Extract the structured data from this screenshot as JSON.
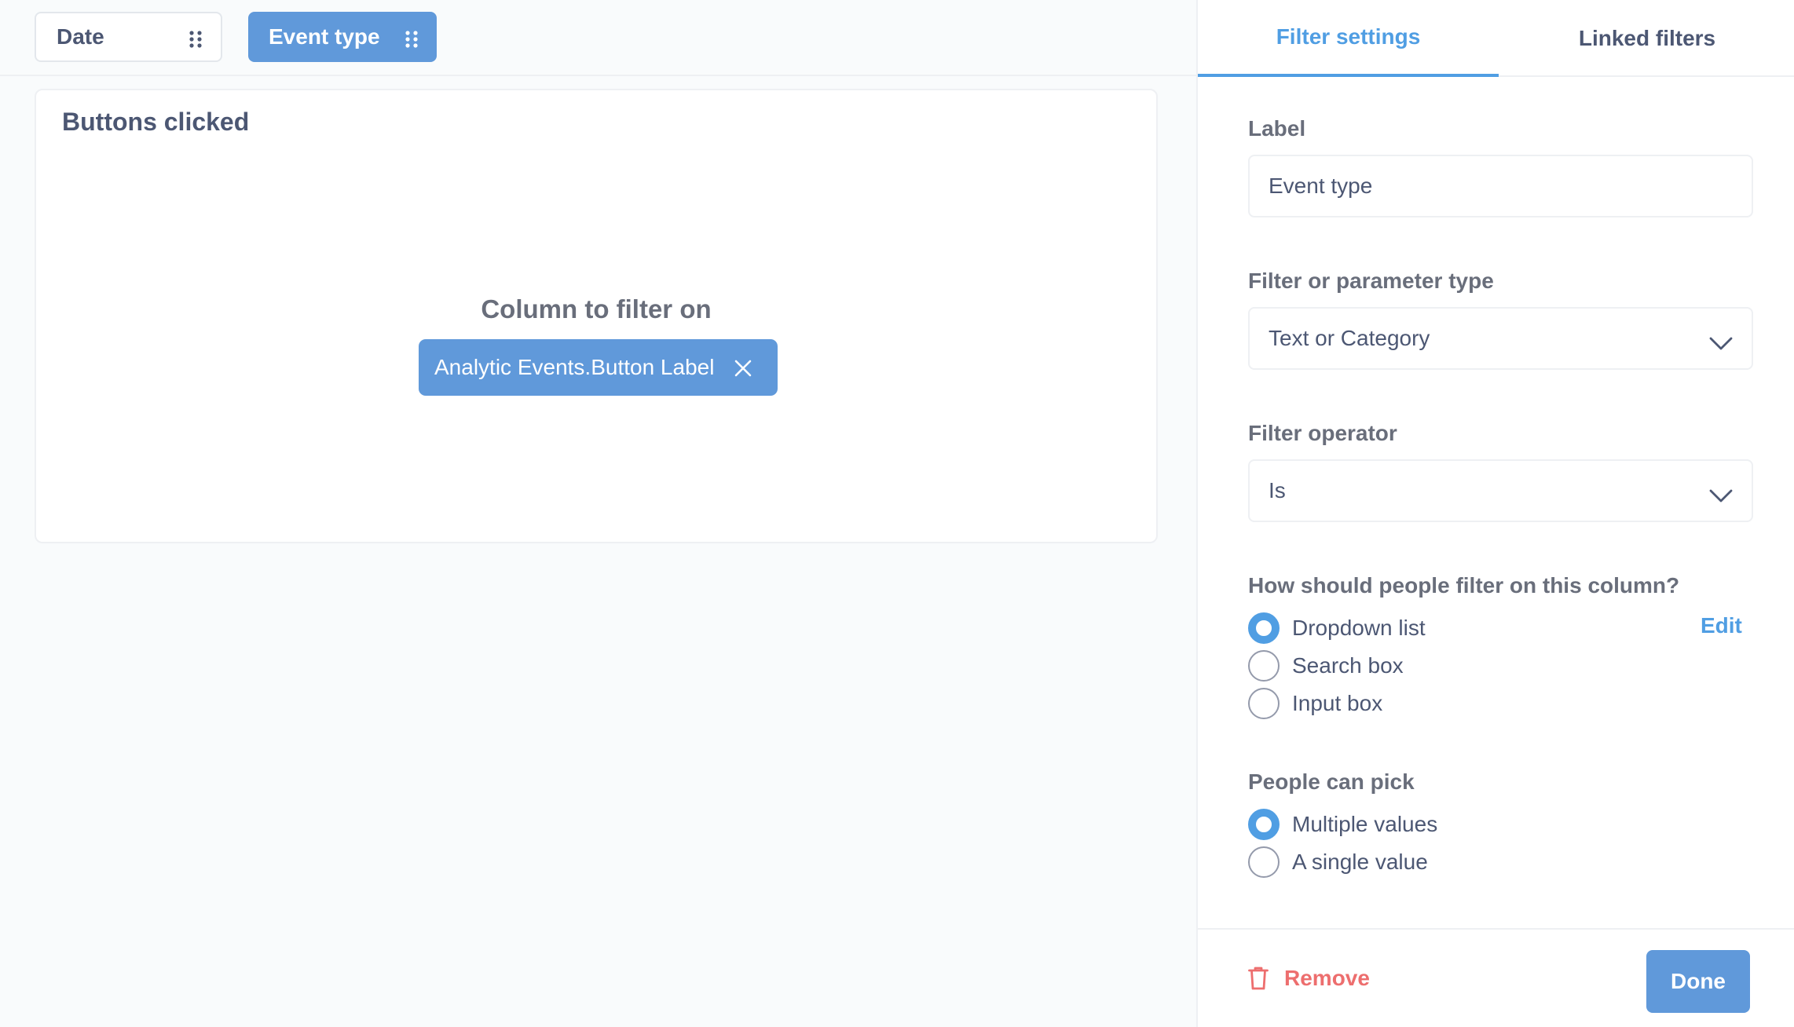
{
  "filter_bar": {
    "chips": [
      {
        "label": "Date",
        "active": false
      },
      {
        "label": "Event type",
        "active": true
      }
    ]
  },
  "card": {
    "title": "Buttons clicked",
    "column_heading": "Column to filter on",
    "column_value": "Analytic Events.Button Label"
  },
  "sidebar": {
    "tabs": [
      {
        "label": "Filter settings",
        "active": true
      },
      {
        "label": "Linked filters",
        "active": false
      }
    ],
    "label_field": {
      "label": "Label",
      "value": "Event type"
    },
    "type_field": {
      "label": "Filter or parameter type",
      "value": "Text or Category"
    },
    "operator_field": {
      "label": "Filter operator",
      "value": "Is"
    },
    "filter_mode": {
      "label": "How should people filter on this column?",
      "edit_label": "Edit",
      "options": [
        {
          "label": "Dropdown list",
          "checked": true
        },
        {
          "label": "Search box",
          "checked": false
        },
        {
          "label": "Input box",
          "checked": false
        }
      ]
    },
    "pick_mode": {
      "label": "People can pick",
      "options": [
        {
          "label": "Multiple values",
          "checked": true
        },
        {
          "label": "A single value",
          "checked": false
        }
      ]
    },
    "footer": {
      "remove_label": "Remove",
      "done_label": "Done"
    }
  },
  "colors": {
    "brand": "#509ee3",
    "chip_active": "#6099da",
    "danger": "#ed6e6e",
    "text": "#4c5773"
  },
  "icons": {
    "grip": "grip-dots-icon",
    "close": "close-icon",
    "chevron": "chevron-down-icon",
    "trash": "trash-icon"
  }
}
